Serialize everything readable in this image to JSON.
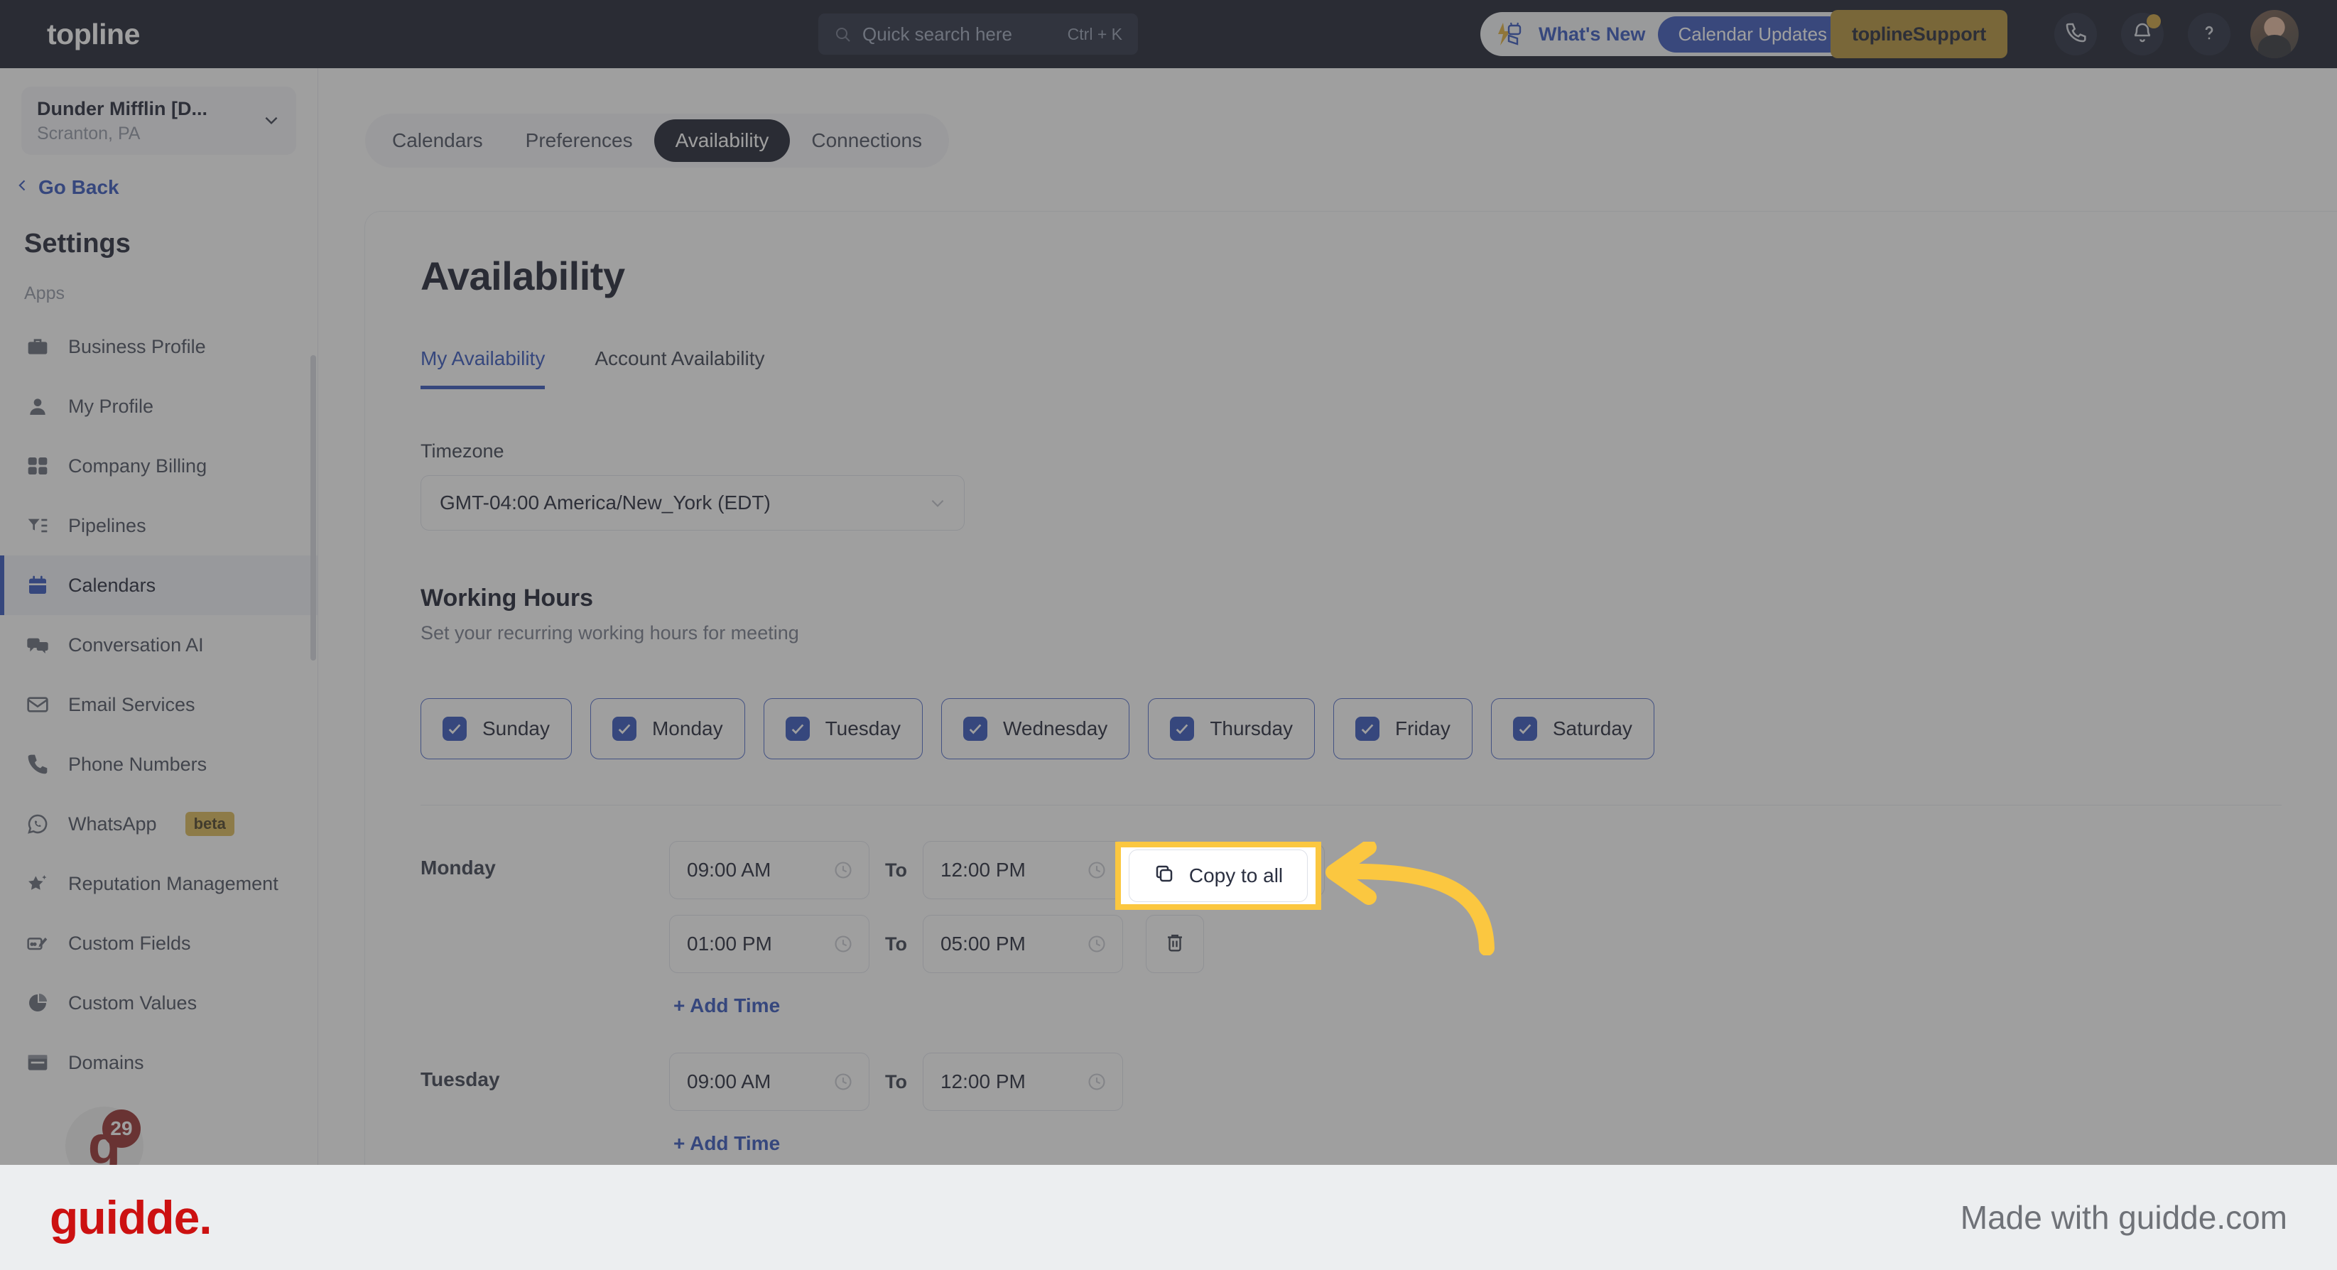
{
  "topbar": {
    "brand": "topline",
    "search": {
      "placeholder": "Quick search here",
      "shortcut": "Ctrl + K",
      "icon": "search-icon"
    },
    "whats_new": {
      "label": "What's New",
      "pill": "Calendar Updates",
      "icon": "lightning-announce-icon"
    },
    "support_button": {
      "brand": "topline",
      "label": " Support"
    },
    "icons": [
      "phone-icon",
      "bell-icon",
      "help-icon"
    ],
    "avatar": "user-avatar"
  },
  "sidebar": {
    "location": {
      "name": "Dunder Mifflin [D...",
      "sub": "Scranton, PA"
    },
    "go_back": "Go Back",
    "title": "Settings",
    "group_label": "Apps",
    "items": [
      {
        "label": "Business Profile",
        "icon": "briefcase-icon",
        "active": false
      },
      {
        "label": "My Profile",
        "icon": "person-icon",
        "active": false
      },
      {
        "label": "Company Billing",
        "icon": "calculator-icon",
        "active": false
      },
      {
        "label": "Pipelines",
        "icon": "funnel-icon",
        "active": false
      },
      {
        "label": "Calendars",
        "icon": "calendar-icon",
        "active": true
      },
      {
        "label": "Conversation AI",
        "icon": "chat-bubbles-icon",
        "active": false
      },
      {
        "label": "Email Services",
        "icon": "envelope-icon",
        "active": false
      },
      {
        "label": "Phone Numbers",
        "icon": "phone-icon",
        "active": false
      },
      {
        "label": "WhatsApp",
        "icon": "whatsapp-icon",
        "active": false,
        "badge": "beta"
      },
      {
        "label": "Reputation Management",
        "icon": "star-sparkle-icon",
        "active": false
      },
      {
        "label": "Custom Fields",
        "icon": "pencil-card-icon",
        "active": false
      },
      {
        "label": "Custom Values",
        "icon": "pie-chart-icon",
        "active": false
      },
      {
        "label": "Domains",
        "icon": "browser-window-icon",
        "active": false
      }
    ],
    "chat_fab": {
      "glyph": "g",
      "badge": "29"
    }
  },
  "main": {
    "segments": [
      {
        "label": "Calendars",
        "active": false
      },
      {
        "label": "Preferences",
        "active": false
      },
      {
        "label": "Availability",
        "active": true
      },
      {
        "label": "Connections",
        "active": false
      }
    ],
    "page_title": "Availability",
    "subtabs": [
      {
        "label": "My Availability",
        "active": true
      },
      {
        "label": "Account Availability",
        "active": false
      }
    ],
    "timezone": {
      "label": "Timezone",
      "value": "GMT-04:00 America/New_York (EDT)"
    },
    "working_hours": {
      "title": "Working Hours",
      "subtitle": "Set your recurring working hours for meeting"
    },
    "days": [
      {
        "name": "Sunday",
        "checked": true
      },
      {
        "name": "Monday",
        "checked": true
      },
      {
        "name": "Tuesday",
        "checked": true
      },
      {
        "name": "Wednesday",
        "checked": true
      },
      {
        "name": "Thursday",
        "checked": true
      },
      {
        "name": "Friday",
        "checked": true
      },
      {
        "name": "Saturday",
        "checked": true
      }
    ],
    "to_word": "To",
    "add_time_label": "+ Add Time",
    "copy_to_all_label": "Copy to all",
    "schedule": [
      {
        "day": "Monday",
        "rows": [
          {
            "from": "09:00 AM",
            "to": "12:00 PM",
            "action": "copy"
          },
          {
            "from": "01:00 PM",
            "to": "05:00 PM",
            "action": "delete"
          }
        ]
      },
      {
        "day": "Tuesday",
        "rows": [
          {
            "from": "09:00 AM",
            "to": "12:00 PM",
            "action": "none"
          }
        ]
      }
    ]
  },
  "footer": {
    "logo": "guidde.",
    "made_with": "Made with guidde.com"
  },
  "colors": {
    "navy": "#0b1020",
    "accent_blue": "#2547b8",
    "highlight_yellow": "#fbc740",
    "guidde_red": "#cc1111",
    "support_gold": "#b08a2b"
  }
}
